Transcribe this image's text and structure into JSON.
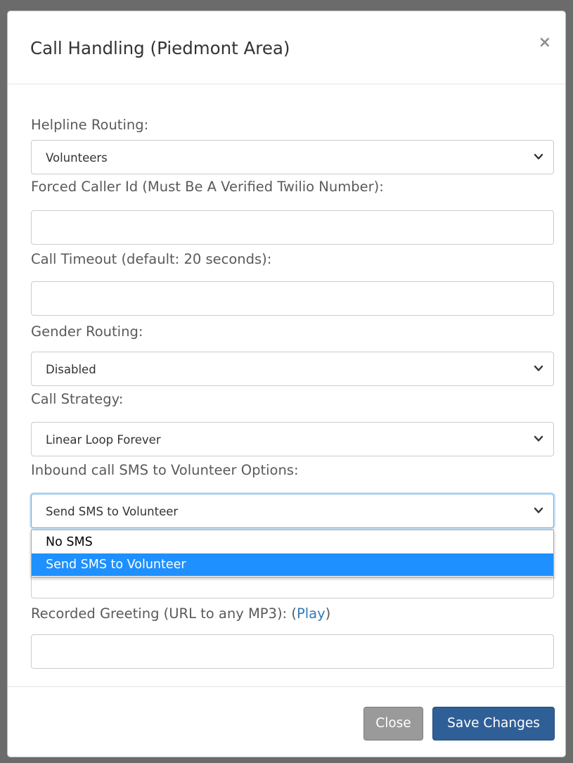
{
  "modal": {
    "title": "Call Handling (Piedmont Area)",
    "close_symbol": "×"
  },
  "fields": {
    "helpline_routing": {
      "label": "Helpline Routing:",
      "value": "Volunteers"
    },
    "forced_caller_id": {
      "label": "Forced Caller Id (Must Be A Verified Twilio Number):",
      "value": ""
    },
    "call_timeout": {
      "label": "Call Timeout (default: 20 seconds):",
      "value": ""
    },
    "gender_routing": {
      "label": "Gender Routing:",
      "value": "Disabled"
    },
    "call_strategy": {
      "label": "Call Strategy:",
      "value": "Linear Loop Forever"
    },
    "inbound_sms": {
      "label": "Inbound call SMS to Volunteer Options:",
      "value": "Send SMS to Volunteer",
      "options": [
        "No SMS",
        "Send SMS to Volunteer"
      ],
      "selected_index": 1
    },
    "recorded_greeting": {
      "label": "Recorded Greeting (URL to any MP3): (",
      "link_text": "Play",
      "label_suffix": ")",
      "value": ""
    }
  },
  "footer": {
    "close_label": "Close",
    "save_label": "Save Changes"
  },
  "colors": {
    "primary_button": "#2f5f97",
    "secondary_button": "#9a9a9a",
    "dropdown_highlight": "#1e90ff",
    "link": "#337ab7"
  },
  "icons": {
    "dropdown_arrow": "chevron-down-icon",
    "close": "close-icon"
  }
}
